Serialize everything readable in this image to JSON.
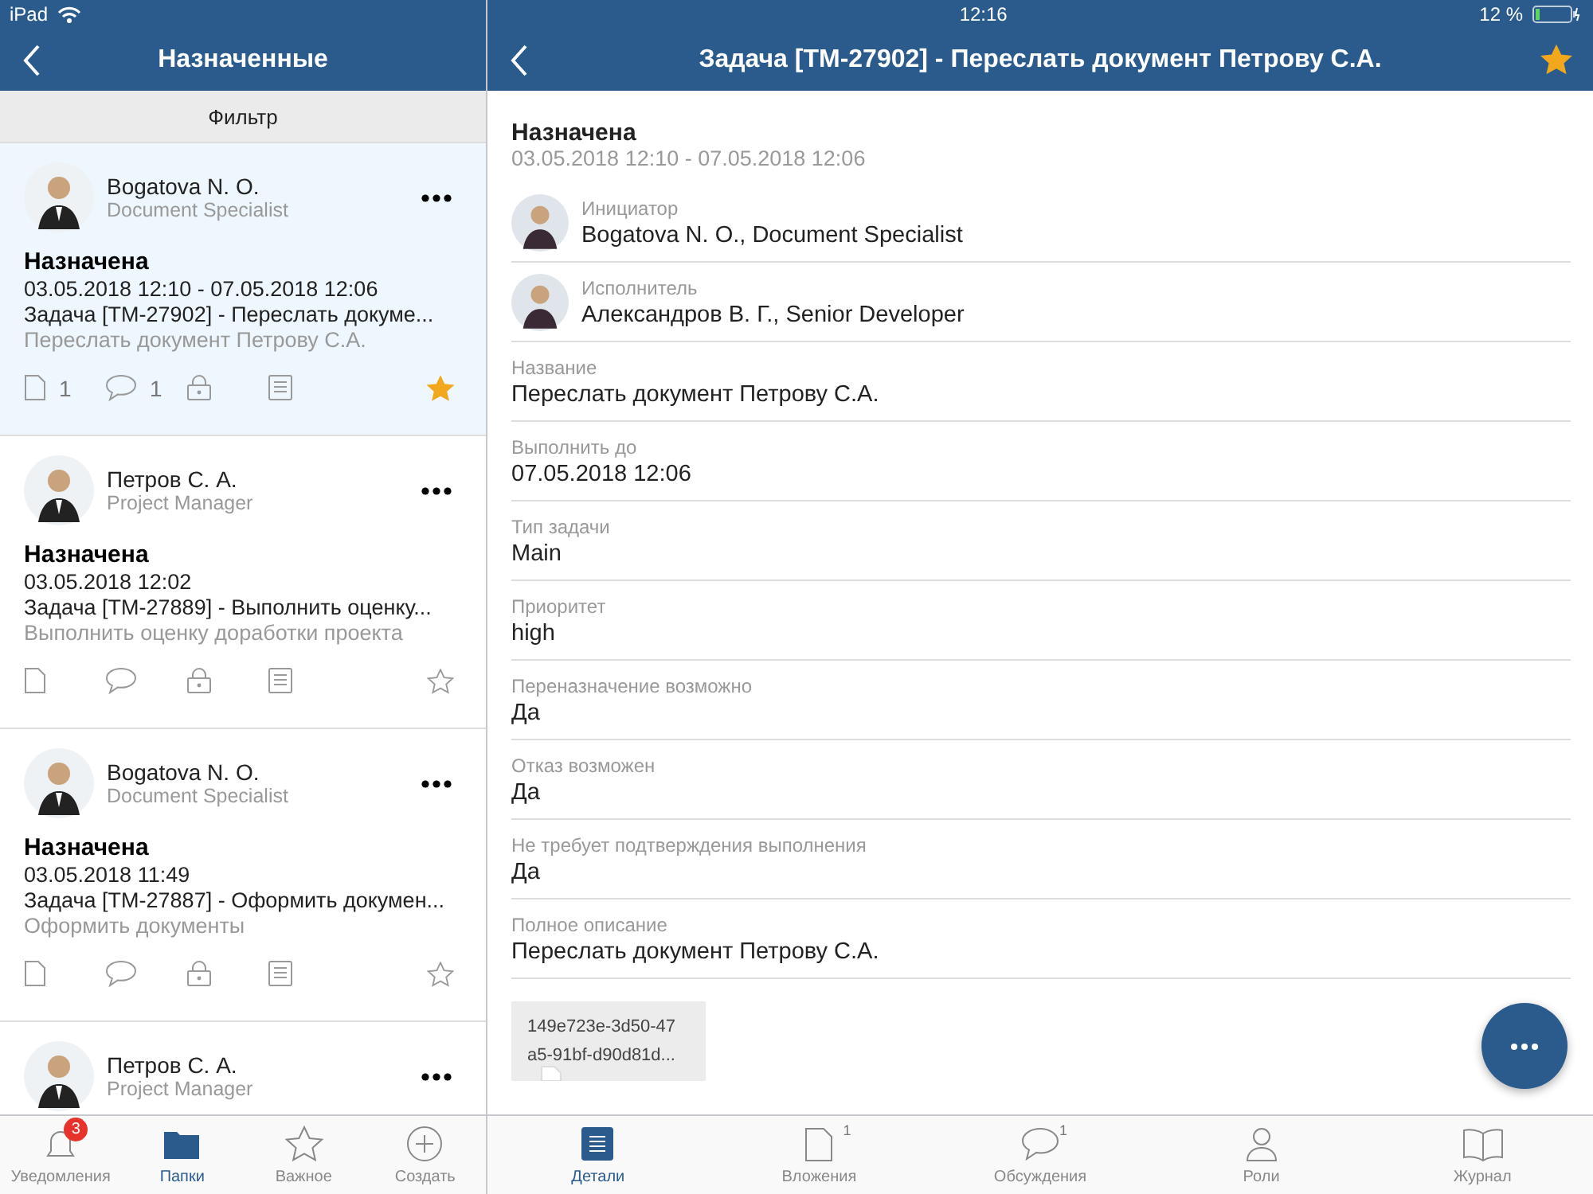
{
  "status_bar": {
    "device": "iPad",
    "time": "12:16",
    "battery": "12 %"
  },
  "list_panel": {
    "title": "Назначенные",
    "filter": "Фильтр",
    "cards": [
      {
        "name": "Bogatova N. O.",
        "role": "Document Specialist",
        "status": "Назначена",
        "dates": "03.05.2018 12:10 - 07.05.2018 12:06",
        "subject": "Задача [TM-27902] - Переслать докуме...",
        "description": "Переслать документ Петрову С.А.",
        "attachments": "1",
        "comments": "1",
        "selected": true,
        "starred": true
      },
      {
        "name": "Петров С. А.",
        "role": "Project Manager",
        "status": "Назначена",
        "dates": "03.05.2018 12:02",
        "subject": "Задача [TM-27889] - Выполнить оценку...",
        "description": "Выполнить оценку доработки проекта",
        "selected": false,
        "starred": false
      },
      {
        "name": "Bogatova N. O.",
        "role": "Document Specialist",
        "status": "Назначена",
        "dates": "03.05.2018 11:49",
        "subject": "Задача [TM-27887] - Оформить докумен...",
        "description": "Оформить документы",
        "selected": false,
        "starred": false
      },
      {
        "name": "Петров С. А.",
        "role": "Project Manager",
        "selected": false
      }
    ],
    "tabs": [
      {
        "label": "Уведомления",
        "badge": "3",
        "selected": false
      },
      {
        "label": "Папки",
        "selected": true
      },
      {
        "label": "Важное",
        "selected": false
      },
      {
        "label": "Создать",
        "selected": false
      }
    ]
  },
  "detail_panel": {
    "title": "Задача [TM-27902] - Переслать документ Петрову С.А.",
    "starred": true,
    "state": "Назначена",
    "dates": "03.05.2018 12:10 - 07.05.2018 12:06",
    "fields": [
      {
        "kind": "person",
        "label": "Инициатор",
        "value": "Bogatova N. O., Document Specialist"
      },
      {
        "kind": "person",
        "label": "Исполнитель",
        "value": "Александров В. Г., Senior Developer"
      },
      {
        "kind": "text",
        "label": "Название",
        "value": "Переслать документ Петрову С.А."
      },
      {
        "kind": "text",
        "label": "Выполнить до",
        "value": "07.05.2018 12:06"
      },
      {
        "kind": "text",
        "label": "Тип задачи",
        "value": "Main"
      },
      {
        "kind": "text",
        "label": "Приоритет",
        "value": "high"
      },
      {
        "kind": "text",
        "label": "Переназначение возможно",
        "value": "Да"
      },
      {
        "kind": "text",
        "label": "Отказ возможен",
        "value": "Да"
      },
      {
        "kind": "text",
        "label": "Не требует подтверждения выполнения",
        "value": "Да"
      },
      {
        "kind": "text",
        "label": "Полное описание",
        "value": "Переслать документ Петрову С.А."
      }
    ],
    "attachment": {
      "name_lines": [
        "149e723e-3d50-47",
        "a5-91bf-d90d81d..."
      ]
    },
    "tabs": [
      {
        "label": "Детали",
        "selected": true
      },
      {
        "label": "Вложения",
        "count": "1",
        "selected": false
      },
      {
        "label": "Обсуждения",
        "count": "1",
        "selected": false
      },
      {
        "label": "Роли",
        "selected": false
      },
      {
        "label": "Журнал",
        "selected": false
      }
    ]
  }
}
